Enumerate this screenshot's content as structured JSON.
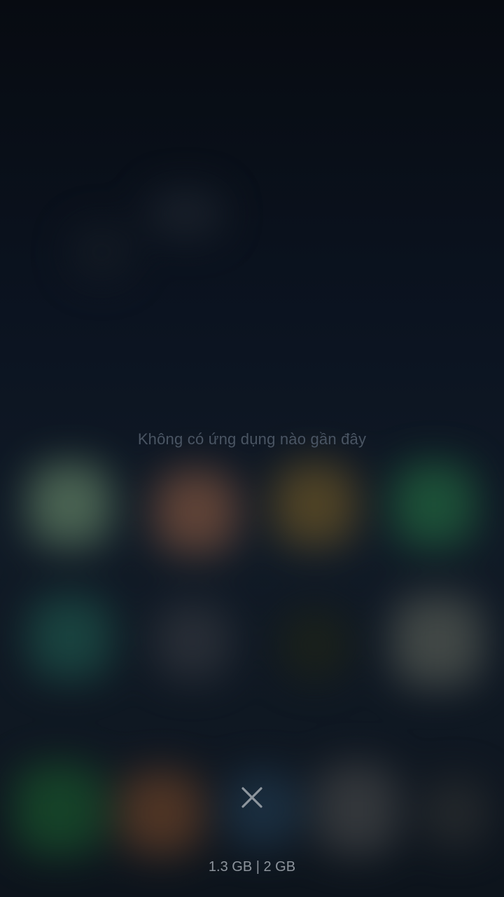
{
  "recents": {
    "empty_message": "Không có ứng dụng nào gần đây"
  },
  "footer": {
    "close_icon": "close-icon",
    "memory_status": "1.3 GB | 2 GB"
  },
  "colors": {
    "background": "#0a1019",
    "empty_text": "#4a5563",
    "memory_text": "#8d949c",
    "close_icon": "#8e969e"
  }
}
